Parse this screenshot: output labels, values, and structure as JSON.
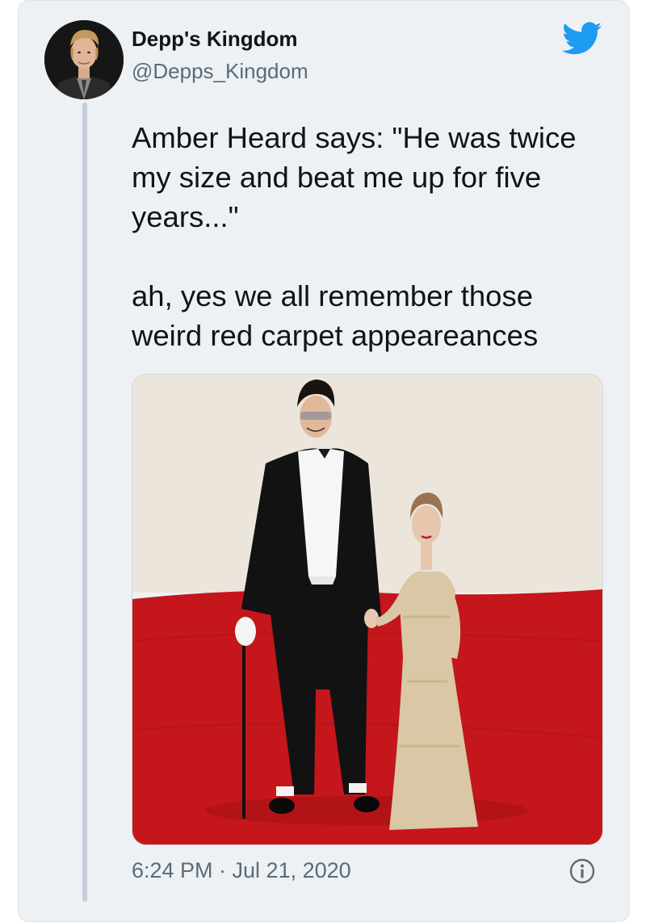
{
  "tweet": {
    "display_name": "Depp's Kingdom",
    "handle": "@Depps_Kingdom",
    "text": "Amber Heard says: \"He was twice my size and beat me up for five years...\"\n\nah, yes we all remember those weird red carpet appeareances",
    "timestamp": "6:24 PM · Jul 21, 2020"
  },
  "icons": {
    "platform": "twitter-bird-icon",
    "info": "info-icon"
  },
  "colors": {
    "brand": "#1d9bf0",
    "text": "#0f1419",
    "secondary_text": "#5b6b78",
    "card_bg": "#edf1f4"
  }
}
